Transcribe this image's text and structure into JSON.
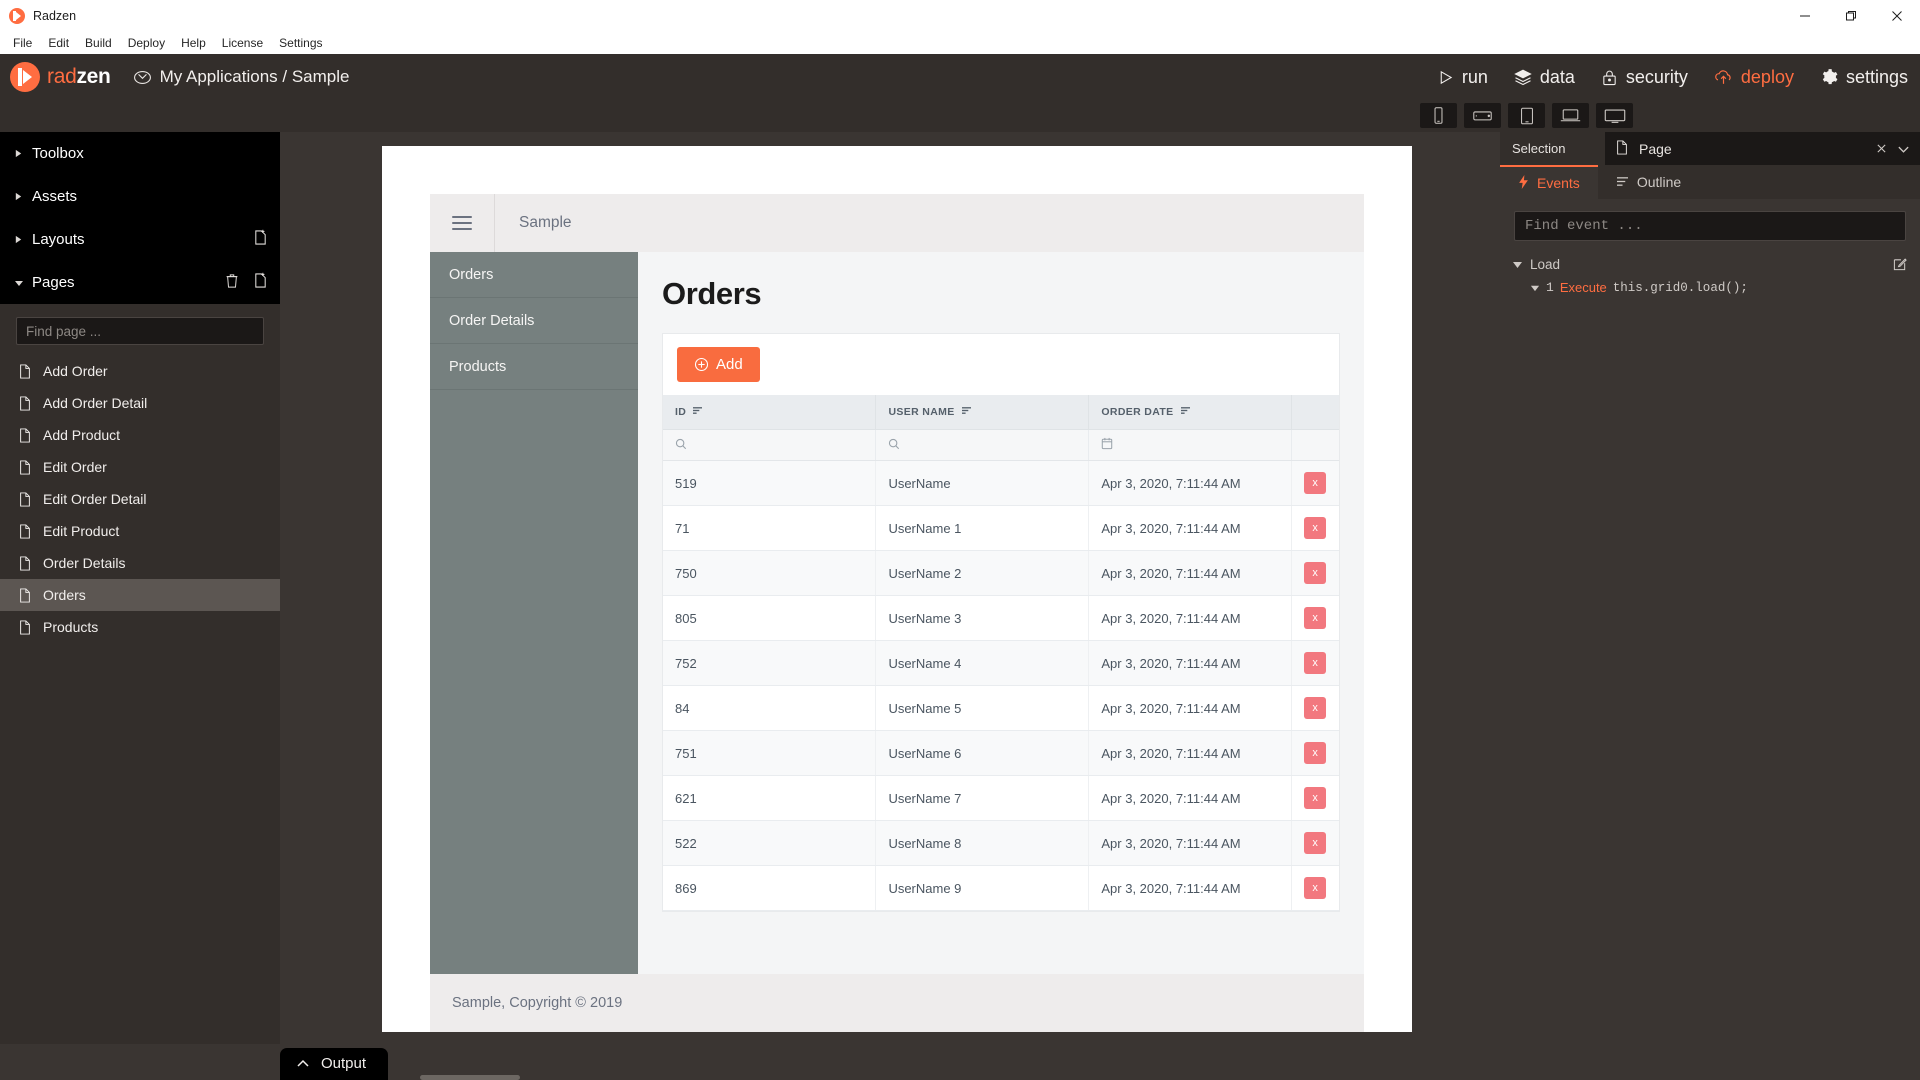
{
  "window": {
    "title": "Radzen",
    "controls": {
      "minimize": "minimize-icon",
      "maximize": "maximize-icon",
      "close": "close-icon"
    }
  },
  "menubar": {
    "items": [
      "File",
      "Edit",
      "Build",
      "Deploy",
      "Help",
      "License",
      "Settings"
    ]
  },
  "brandbar": {
    "logo_rad": "rad",
    "logo_zen": "zen",
    "breadcrumb": "My Applications / Sample",
    "nav": [
      {
        "label": "run",
        "icon": "play-icon",
        "accent": false
      },
      {
        "label": "data",
        "icon": "layers-icon",
        "accent": false
      },
      {
        "label": "security",
        "icon": "lock-icon",
        "accent": false
      },
      {
        "label": "deploy",
        "icon": "cloud-upload-icon",
        "accent": true
      },
      {
        "label": "settings",
        "icon": "gear-icon",
        "accent": false
      }
    ]
  },
  "device_toolbar": {
    "buttons": [
      "phone-portrait-icon",
      "phone-landscape-icon",
      "tablet-icon",
      "laptop-icon",
      "desktop-icon"
    ]
  },
  "sidebar": {
    "sections": [
      {
        "label": "Toolbox",
        "expanded": false
      },
      {
        "label": "Assets",
        "expanded": false
      },
      {
        "label": "Layouts",
        "expanded": false
      },
      {
        "label": "Pages",
        "expanded": true
      }
    ],
    "find_placeholder": "Find page ...",
    "find_value": "",
    "pages": [
      {
        "label": "Add Order",
        "selected": false
      },
      {
        "label": "Add Order Detail",
        "selected": false
      },
      {
        "label": "Add Product",
        "selected": false
      },
      {
        "label": "Edit Order",
        "selected": false
      },
      {
        "label": "Edit Order Detail",
        "selected": false
      },
      {
        "label": "Edit Product",
        "selected": false
      },
      {
        "label": "Order Details",
        "selected": false
      },
      {
        "label": "Orders",
        "selected": true
      },
      {
        "label": "Products",
        "selected": false
      }
    ]
  },
  "preview": {
    "app_name": "Sample",
    "side_menu": [
      "Orders",
      "Order Details",
      "Products"
    ],
    "page_title": "Orders",
    "add_button": "Add",
    "footer": "Sample, Copyright © 2019",
    "grid": {
      "columns": [
        "ID",
        "USER NAME",
        "ORDER DATE"
      ],
      "filter_icons": [
        "search-icon",
        "search-icon",
        "calendar-icon"
      ],
      "delete_label": "x",
      "rows": [
        {
          "id": "519",
          "user_name": "UserName",
          "order_date": "Apr 3, 2020, 7:11:44 AM"
        },
        {
          "id": "71",
          "user_name": "UserName 1",
          "order_date": "Apr 3, 2020, 7:11:44 AM"
        },
        {
          "id": "750",
          "user_name": "UserName 2",
          "order_date": "Apr 3, 2020, 7:11:44 AM"
        },
        {
          "id": "805",
          "user_name": "UserName 3",
          "order_date": "Apr 3, 2020, 7:11:44 AM"
        },
        {
          "id": "752",
          "user_name": "UserName 4",
          "order_date": "Apr 3, 2020, 7:11:44 AM"
        },
        {
          "id": "84",
          "user_name": "UserName 5",
          "order_date": "Apr 3, 2020, 7:11:44 AM"
        },
        {
          "id": "751",
          "user_name": "UserName 6",
          "order_date": "Apr 3, 2020, 7:11:44 AM"
        },
        {
          "id": "621",
          "user_name": "UserName 7",
          "order_date": "Apr 3, 2020, 7:11:44 AM"
        },
        {
          "id": "522",
          "user_name": "UserName 8",
          "order_date": "Apr 3, 2020, 7:11:44 AM"
        },
        {
          "id": "869",
          "user_name": "UserName 9",
          "order_date": "Apr 3, 2020, 7:11:44 AM"
        }
      ]
    }
  },
  "rightpanel": {
    "selection_label": "Selection",
    "selected_item": "Page",
    "tabs": [
      {
        "label": "Events",
        "icon": "bolt-icon",
        "active": true
      },
      {
        "label": "Outline",
        "icon": "list-icon",
        "active": false
      }
    ],
    "find_placeholder": "Find event ...",
    "find_value": "",
    "events": [
      {
        "name": "Load",
        "line_number": "1",
        "action": "Execute",
        "code": "this.grid0.load();"
      }
    ]
  },
  "bottombar": {
    "output_label": "Output"
  },
  "colors": {
    "accent": "#ff6d41",
    "add_button": "#f96c3f",
    "delete_button": "#f2787f",
    "panel_bg": "#3a3532",
    "sidebar_bg": "#000000",
    "preview_side": "#76807f"
  }
}
